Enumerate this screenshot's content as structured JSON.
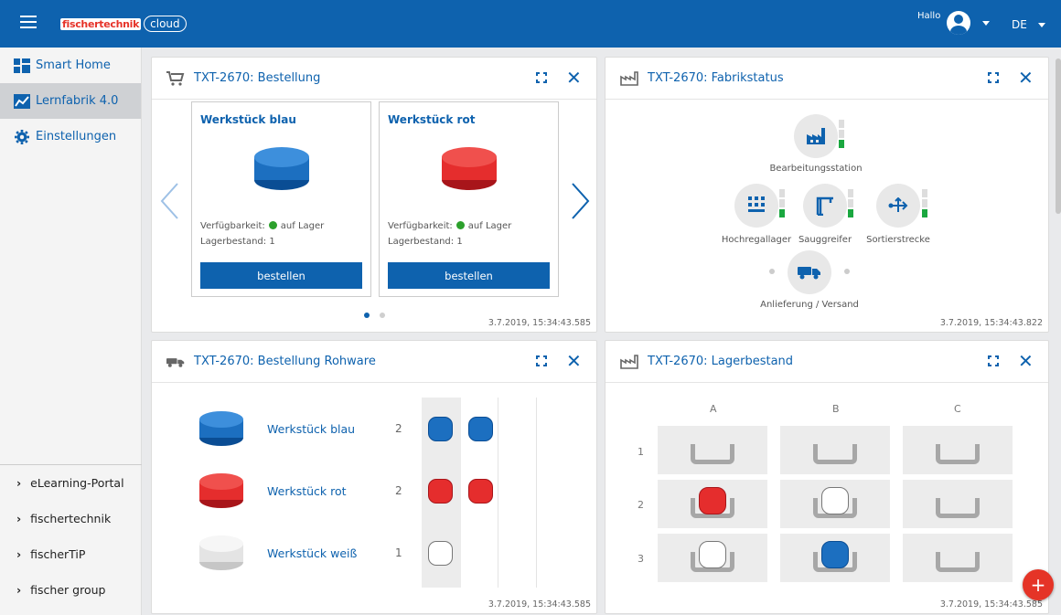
{
  "header": {
    "brand_text": "fischertechnik",
    "cloud_text": "cloud",
    "greeting": "Hallo",
    "language": "DE"
  },
  "sidebar": {
    "items": [
      {
        "label": "Smart Home",
        "icon": "dashboard-icon"
      },
      {
        "label": "Lernfabrik 4.0",
        "icon": "chart-icon",
        "active": true
      },
      {
        "label": "Einstellungen",
        "icon": "gear-icon"
      }
    ],
    "links": [
      {
        "label": "eLearning-Portal"
      },
      {
        "label": "fischertechnik"
      },
      {
        "label": "fischerTiP"
      },
      {
        "label": "fischer group"
      }
    ]
  },
  "order": {
    "title": "TXT-2670: Bestellung",
    "products": [
      {
        "name": "Werkstück blau",
        "availability_label": "Verfügbarkeit:",
        "availability": "auf Lager",
        "stock_label": "Lagerbestand:",
        "stock": "1",
        "button": "bestellen",
        "color": "#1c6fc0"
      },
      {
        "name": "Werkstück rot",
        "availability_label": "Verfügbarkeit:",
        "availability": "auf Lager",
        "stock_label": "Lagerbestand:",
        "stock": "1",
        "button": "bestellen",
        "color": "#e52d2d"
      }
    ],
    "timestamp": "3.7.2019, 15:34:43.585"
  },
  "factory": {
    "title": "TXT-2670: Fabrikstatus",
    "stations": {
      "processing": "Bearbeitungsstation",
      "high_bay": "Hochregallager",
      "vacuum": "Sauggreifer",
      "sorting": "Sortierstrecke",
      "delivery": "Anlieferung / Versand"
    },
    "timestamp": "3.7.2019, 15:34:43.822"
  },
  "raw_order": {
    "title": "TXT-2670: Bestellung Rohware",
    "items": [
      {
        "name": "Werkstück blau",
        "count": "2",
        "color": "#1c6fc0"
      },
      {
        "name": "Werkstück rot",
        "count": "2",
        "color": "#e52d2d"
      },
      {
        "name": "Werkstück weiß",
        "count": "1",
        "color": "#ffffff"
      }
    ],
    "timestamp": "3.7.2019, 15:34:43.585"
  },
  "stock": {
    "title": "TXT-2670: Lagerbestand",
    "columns": [
      "A",
      "B",
      "C"
    ],
    "rows": [
      "1",
      "2",
      "3"
    ],
    "grid": [
      [
        "empty",
        "empty",
        "empty"
      ],
      [
        "red",
        "white",
        "empty"
      ],
      [
        "white",
        "blue",
        "empty"
      ]
    ],
    "timestamp": "3.7.2019, 15:34:43.585"
  }
}
